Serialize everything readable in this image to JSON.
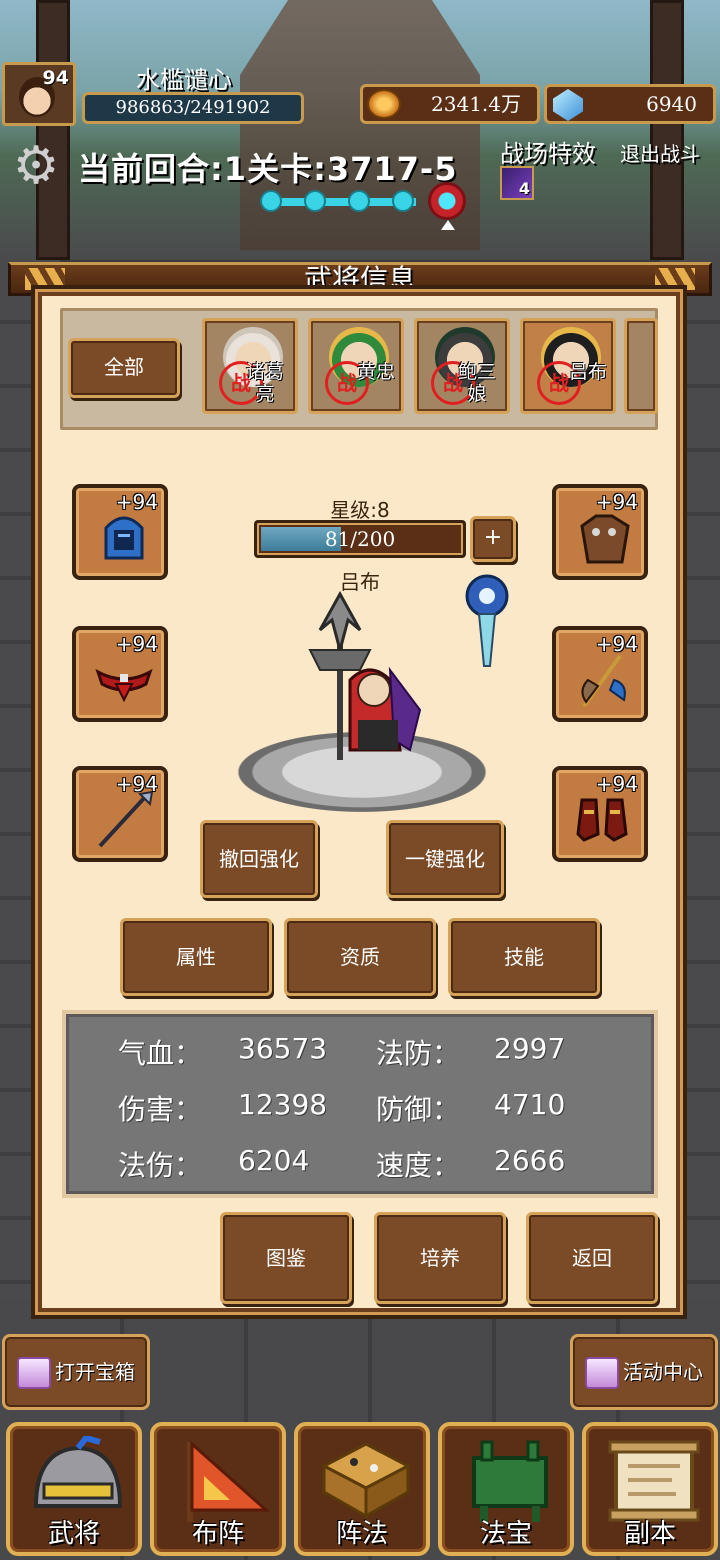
{
  "player": {
    "level": "94",
    "name": "水槛谴心",
    "exp": "986863/2491902"
  },
  "currency": {
    "gold": "2341.4万",
    "gems": "6940"
  },
  "battle": {
    "round_info": "当前回合:1关卡:3717-5",
    "effect_label": "战场特效",
    "exit_label": "退出战斗",
    "effect_count": "4"
  },
  "panel": {
    "title": "武将信息"
  },
  "filter": {
    "all_label": "全部"
  },
  "heroes": [
    {
      "name": "诸葛亮",
      "tag": "战"
    },
    {
      "name": "黄忠",
      "tag": "战"
    },
    {
      "name": "鲍三娘",
      "tag": "战"
    },
    {
      "name": "吕布",
      "tag": "战"
    }
  ],
  "hero": {
    "star_level": "星级:8",
    "star_progress": "81/200",
    "star_fraction": 0.405,
    "name": "吕布"
  },
  "equipment": [
    {
      "slot": "helmet-icon",
      "plus": "+94"
    },
    {
      "slot": "belt-icon",
      "plus": "+94"
    },
    {
      "slot": "spear-icon",
      "plus": "+94"
    },
    {
      "slot": "armor-icon",
      "plus": "+94"
    },
    {
      "slot": "axe-icon",
      "plus": "+94"
    },
    {
      "slot": "boots-icon",
      "plus": "+94"
    }
  ],
  "actions": {
    "revoke": "撤回强化",
    "one_click": "一键强化",
    "plus": "+"
  },
  "tabs": {
    "attributes": "属性",
    "aptitude": "资质",
    "skills": "技能"
  },
  "stats": [
    {
      "label": "气血：",
      "value": "36573"
    },
    {
      "label": "法防：",
      "value": "2997"
    },
    {
      "label": "伤害：",
      "value": "12398"
    },
    {
      "label": "防御：",
      "value": "4710"
    },
    {
      "label": "法伤：",
      "value": "6204"
    },
    {
      "label": "速度：",
      "value": "2666"
    }
  ],
  "bottom_buttons": {
    "codex": "图鉴",
    "train": "培养",
    "back": "返回"
  },
  "quick": {
    "open_chest": "打开宝箱",
    "activity_center": "活动中心"
  },
  "nav": {
    "hero": "武将",
    "formation": "布阵",
    "array": "阵法",
    "treasure": "法宝",
    "dungeon": "副本"
  },
  "colors": {
    "panel_bg": "#fbe8c8",
    "button_brown": "#7b4a27",
    "gold_border": "#d4a259",
    "exp_bar": "#3c7c98"
  }
}
